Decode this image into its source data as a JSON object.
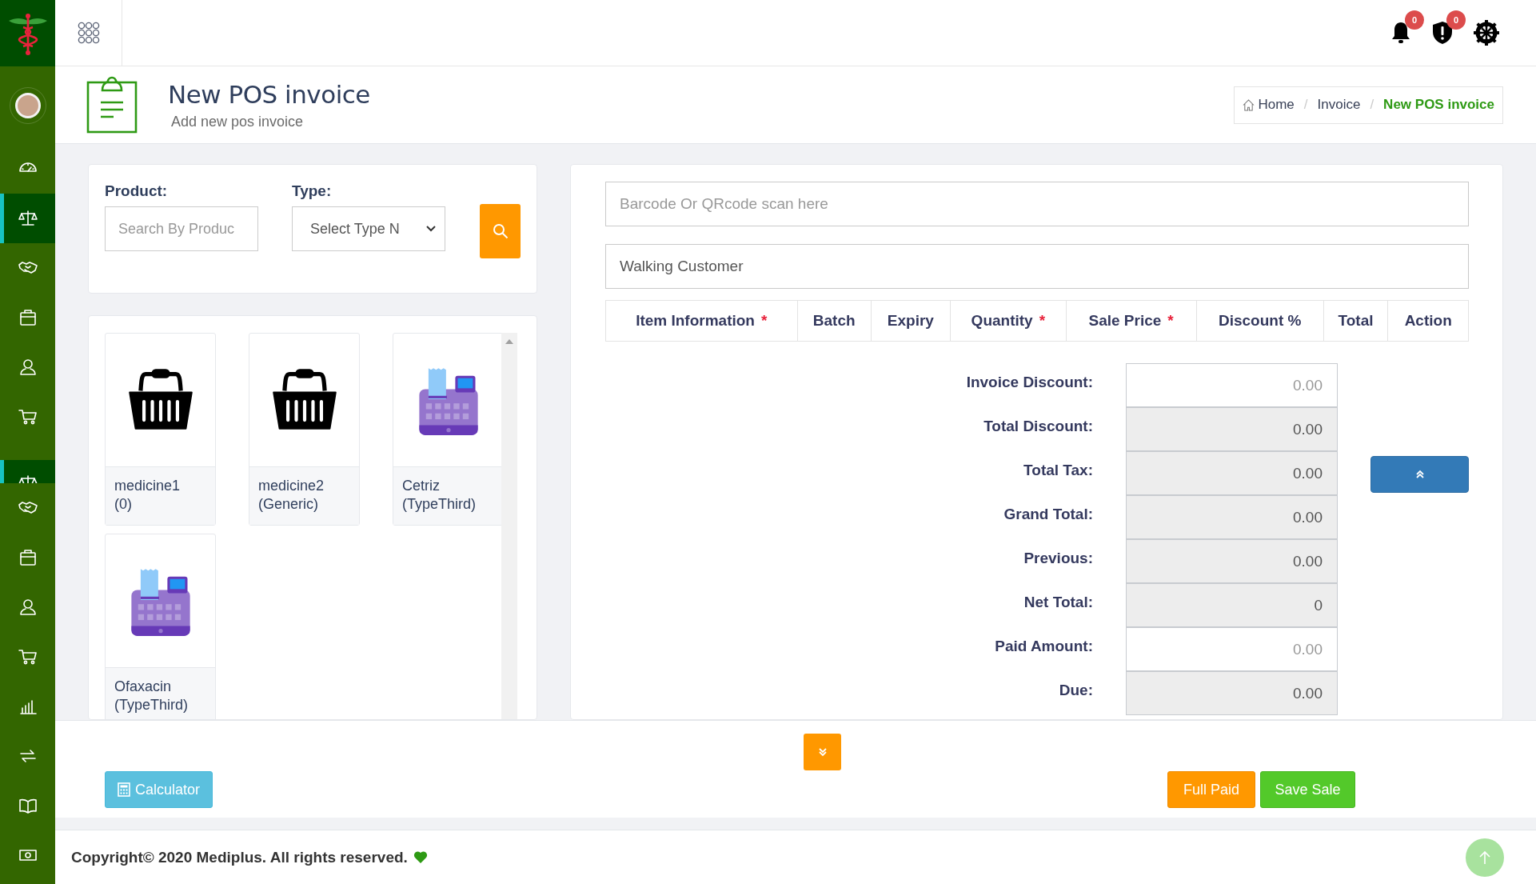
{
  "sidebar": {
    "items": [
      {
        "kind": "gauge",
        "selected": false,
        "clipped": false
      },
      {
        "kind": "scale",
        "selected": true,
        "clipped": false
      },
      {
        "kind": "handshake",
        "selected": false,
        "clipped": false
      },
      {
        "kind": "briefcase",
        "selected": false,
        "clipped": false
      },
      {
        "kind": "user",
        "selected": false,
        "clipped": false
      },
      {
        "kind": "cart",
        "selected": false,
        "clipped": false
      },
      {
        "kind": "scale",
        "selected": true,
        "clipped": true
      },
      {
        "kind": "handshake",
        "selected": false,
        "clipped": false
      },
      {
        "kind": "briefcase",
        "selected": false,
        "clipped": false
      },
      {
        "kind": "user",
        "selected": false,
        "clipped": false
      },
      {
        "kind": "cart",
        "selected": false,
        "clipped": false
      },
      {
        "kind": "chart",
        "selected": false,
        "clipped": false
      },
      {
        "kind": "exchange",
        "selected": false,
        "clipped": false
      },
      {
        "kind": "book",
        "selected": false,
        "clipped": false
      },
      {
        "kind": "money",
        "selected": false,
        "clipped": false
      }
    ]
  },
  "topbar": {
    "notifications": [
      {
        "kind": "bell",
        "badge": "0"
      },
      {
        "kind": "shield",
        "badge": "0"
      }
    ]
  },
  "page_header": {
    "title": "New POS invoice",
    "subtitle": "Add new pos invoice",
    "breadcrumb_separator": "/",
    "breadcrumb": [
      {
        "label": "Home",
        "selected": false
      },
      {
        "label": "Invoice",
        "selected": false
      },
      {
        "label": "New POS invoice",
        "selected": true
      }
    ]
  },
  "filter": {
    "product_label": "Product:",
    "product_placeholder": "Search By Produc",
    "type_label": "Type:",
    "type_value": "Select Type N"
  },
  "products": [
    {
      "name": "medicine1",
      "type": "(0)",
      "kind": "basket"
    },
    {
      "name": "medicine2",
      "type": "(Generic)",
      "kind": "basket"
    },
    {
      "name": "Cetriz",
      "type": "(TypeThird)",
      "kind": "register"
    },
    {
      "name": "Ofaxacin",
      "type": "(TypeThird)",
      "kind": "register"
    }
  ],
  "invoice": {
    "barcode_placeholder": "Barcode Or QRcode scan here",
    "customer": "Walking Customer",
    "columns": [
      {
        "label": "Item Information",
        "mark": "*"
      },
      {
        "label": "Batch"
      },
      {
        "label": "Expiry"
      },
      {
        "label": "Quantity",
        "mark": "*"
      },
      {
        "label": "Sale Price",
        "mark": "*"
      },
      {
        "label": "Discount %"
      },
      {
        "label": "Total"
      },
      {
        "label": "Action"
      }
    ],
    "totals": [
      {
        "label": "Invoice Discount:",
        "kind": "input",
        "placeholder": "0.00"
      },
      {
        "label": "Total Discount:",
        "kind": "readonly",
        "value": "0.00"
      },
      {
        "label": "Total Tax:",
        "kind": "readonly",
        "value": "0.00"
      },
      {
        "label": "Grand Total:",
        "kind": "readonly",
        "value": "0.00"
      },
      {
        "label": "Previous:",
        "kind": "readonly",
        "value": "0.00"
      },
      {
        "label": "Net Total:",
        "kind": "readonly",
        "value": "0"
      },
      {
        "label": "Paid Amount:",
        "kind": "input",
        "placeholder": "0.00"
      },
      {
        "label": "Due:",
        "kind": "readonly",
        "value": "0.00"
      }
    ]
  },
  "actions": {
    "calculator": "Calculator",
    "full_paid": "Full Paid",
    "save": "Save Sale"
  },
  "footer": {
    "copyright": "Copyright© 2020 Mediplus. All rights reserved."
  }
}
